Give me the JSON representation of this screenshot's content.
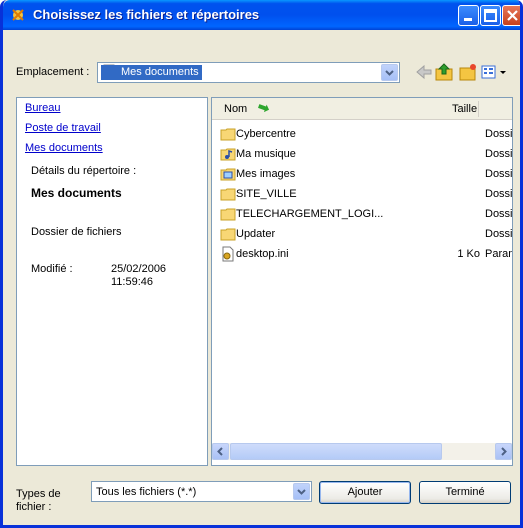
{
  "window": {
    "title": "Choisissez les fichiers et répertoires"
  },
  "location": {
    "label": "Emplacement :",
    "value": "Mes documents"
  },
  "left_panel": {
    "links": [
      "Bureau",
      "Poste de travail",
      "Mes documents"
    ],
    "details_label": "Détails du répertoire :",
    "folder_name": "Mes documents",
    "folder_type": "Dossier de fichiers",
    "modified_label": "Modifié :",
    "modified_date": "25/02/2006",
    "modified_time": "11:59:46"
  },
  "file_list": {
    "col_name": "Nom",
    "col_size": "Taille",
    "rows": [
      {
        "name": "Cybercentre",
        "size": "",
        "type": "Dossie",
        "icon": "folder-icon"
      },
      {
        "name": "Ma musique",
        "size": "",
        "type": "Dossie",
        "icon": "music-folder-icon"
      },
      {
        "name": "Mes images",
        "size": "",
        "type": "Dossie",
        "icon": "pictures-folder-icon"
      },
      {
        "name": "SITE_VILLE",
        "size": "",
        "type": "Dossie",
        "icon": "folder-icon"
      },
      {
        "name": "TELECHARGEMENT_LOGI...",
        "size": "",
        "type": "Dossie",
        "icon": "folder-icon"
      },
      {
        "name": "Updater",
        "size": "",
        "type": "Dossie",
        "icon": "folder-icon"
      },
      {
        "name": "desktop.ini",
        "size": "1 Ko",
        "type": "Param",
        "icon": "ini-file-icon"
      }
    ]
  },
  "bottom": {
    "types_label_line1": "Types de",
    "types_label_line2": "fichier :",
    "types_value": "Tous les fichiers (*.*)",
    "add_button": "Ajouter",
    "done_button": "Terminé"
  },
  "colors": {
    "titlebar": "#0053ee",
    "selection": "#316ac5",
    "link": "#0000cc"
  }
}
